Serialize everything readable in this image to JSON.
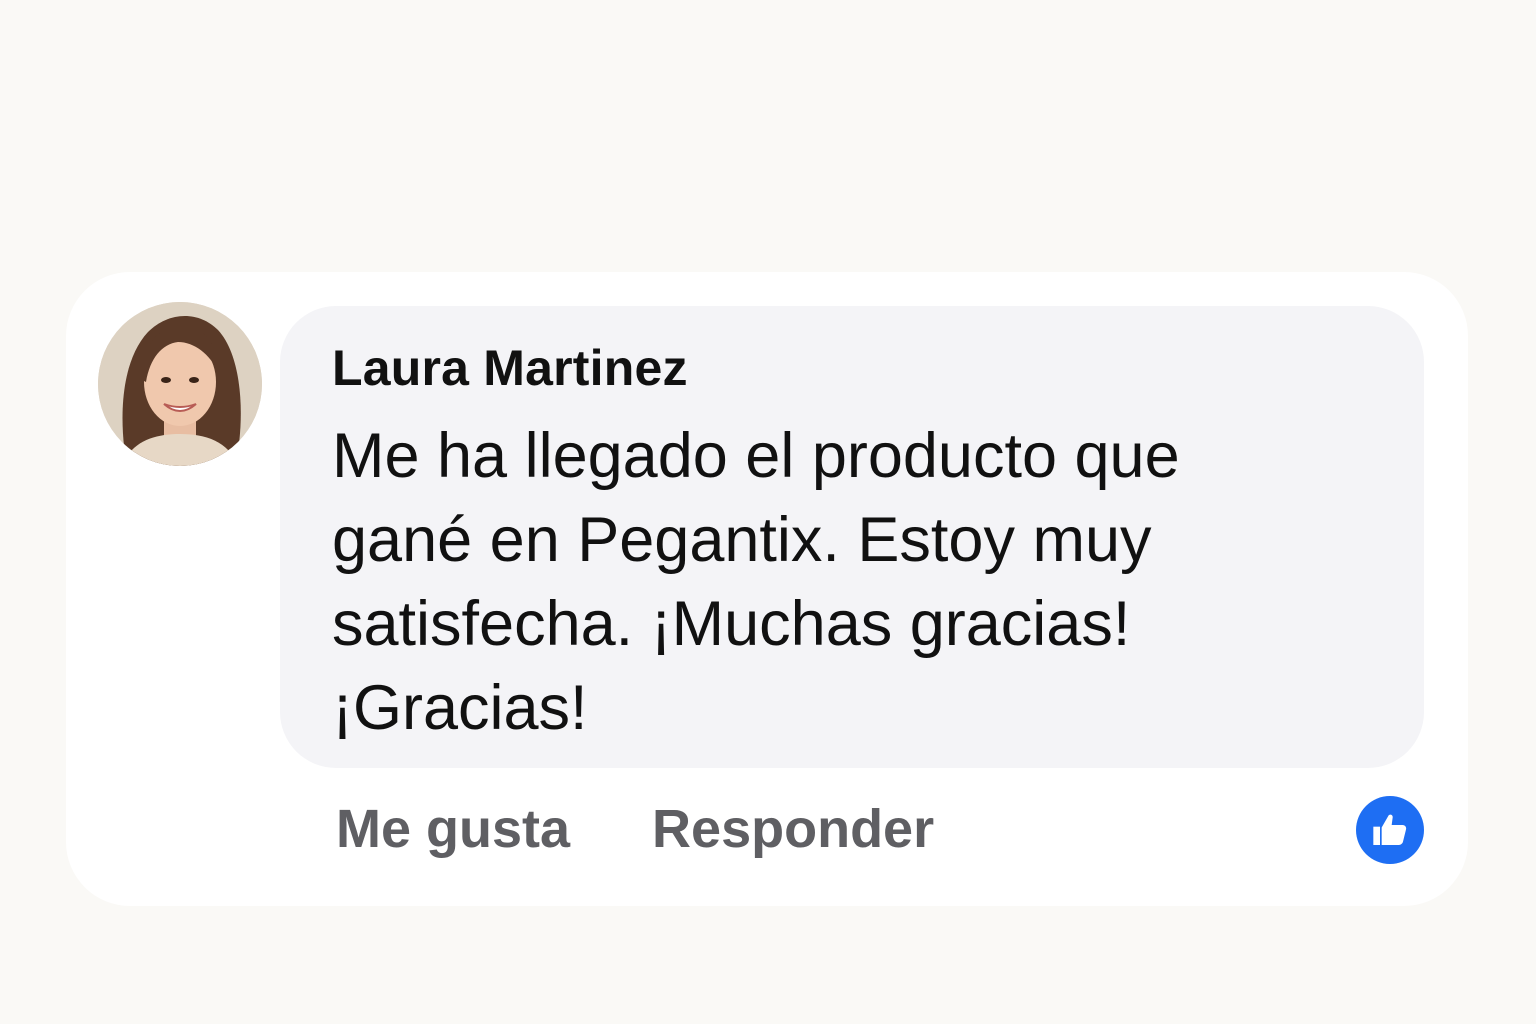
{
  "comment": {
    "author": "Laura Martinez",
    "text": "Me ha llegado el producto que gané en Pegantix. Estoy muy satisfecha. ¡Muchas gracias! ¡Gracias!",
    "avatar_icon": "user-avatar-photo"
  },
  "actions": {
    "like_label": "Me gusta",
    "reply_label": "Responder"
  },
  "reaction": {
    "icon": "thumbs-up-icon",
    "color": "#1e6ef3"
  },
  "colors": {
    "background": "#faf9f6",
    "card": "#ffffff",
    "bubble": "#f4f4f7",
    "action_text": "#5f5f63"
  }
}
